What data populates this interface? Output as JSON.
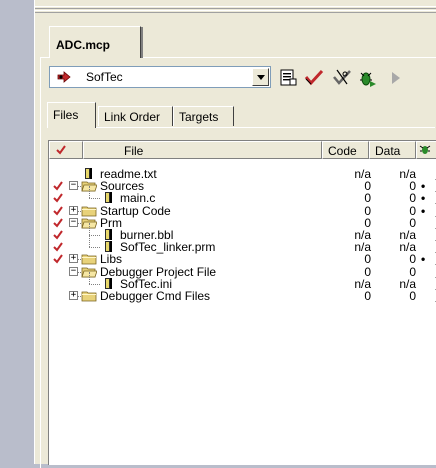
{
  "window": {
    "tab_label": "ADC.mcp"
  },
  "toolbar": {
    "target": "SofTec",
    "buttons": [
      "target-settings",
      "make",
      "debug",
      "run",
      "play"
    ]
  },
  "subtabs": [
    "Files",
    "Link Order",
    "Targets"
  ],
  "columns": {
    "file": "File",
    "code": "Code",
    "data": "Data"
  },
  "rows": [
    {
      "name": "readme.txt",
      "code": "n/a",
      "data": "n/a",
      "checked": false,
      "type": "file",
      "depth": 0,
      "dot": ""
    },
    {
      "name": "Sources",
      "code": "0",
      "data": "0",
      "checked": true,
      "type": "folder-open",
      "depth": 0,
      "dot": "•"
    },
    {
      "name": "main.c",
      "code": "0",
      "data": "0",
      "checked": true,
      "type": "file",
      "depth": 1,
      "dot": "•"
    },
    {
      "name": "Startup Code",
      "code": "0",
      "data": "0",
      "checked": true,
      "type": "folder-closed",
      "depth": 0,
      "dot": "•"
    },
    {
      "name": "Prm",
      "code": "0",
      "data": "0",
      "checked": true,
      "type": "folder-open",
      "depth": 0,
      "dot": ""
    },
    {
      "name": "burner.bbl",
      "code": "n/a",
      "data": "n/a",
      "checked": true,
      "type": "file",
      "depth": 1,
      "dot": ""
    },
    {
      "name": "SofTec_linker.prm",
      "code": "n/a",
      "data": "n/a",
      "checked": true,
      "type": "file",
      "depth": 1,
      "dot": ""
    },
    {
      "name": "Libs",
      "code": "0",
      "data": "0",
      "checked": true,
      "type": "folder-closed",
      "depth": 0,
      "dot": "•"
    },
    {
      "name": "Debugger Project File",
      "code": "0",
      "data": "0",
      "checked": false,
      "type": "folder-open",
      "depth": 0,
      "dot": ""
    },
    {
      "name": "SofTec.ini",
      "code": "n/a",
      "data": "n/a",
      "checked": false,
      "type": "file",
      "depth": 1,
      "dot": ""
    },
    {
      "name": "Debugger Cmd Files",
      "code": "0",
      "data": "0",
      "checked": false,
      "type": "folder-closed",
      "depth": 0,
      "dot": ""
    }
  ],
  "colors": {
    "panel": "#ece9d8",
    "gutter": "#b9bdcb",
    "check": "#c0282c"
  }
}
